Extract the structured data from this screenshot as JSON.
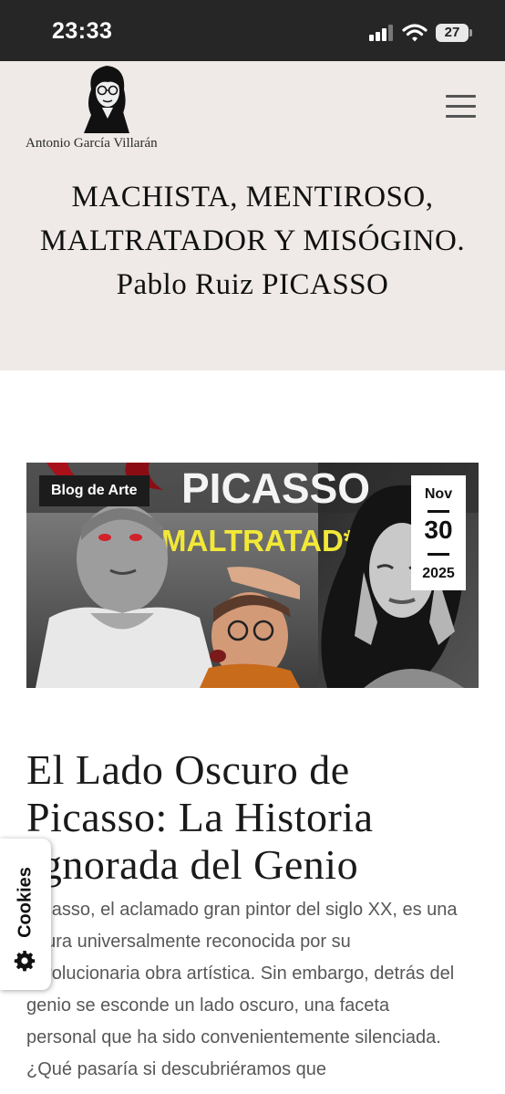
{
  "status_bar": {
    "time": "23:33",
    "battery": "27",
    "icons": [
      "signal-icon",
      "wifi-icon",
      "battery-icon"
    ]
  },
  "header": {
    "site_name": "Antonio García Villarán",
    "menu_icon": "hamburger-menu-icon"
  },
  "page": {
    "title": "MACHISTA, MENTIROSO, MALTRATADOR Y MISÓGINO. Pablo Ruiz PICASSO"
  },
  "post": {
    "category": "Blog de Arte",
    "date": {
      "month": "Nov",
      "day": "30",
      "year": "2025"
    },
    "image_text": {
      "headline": "PICASSO",
      "overlay": "MALTRATAD*R"
    },
    "title": "El Lado Oscuro de Picasso: La Historia Ignorada del Genio",
    "excerpt": "Picasso, el aclamado gran pintor del siglo XX, es una figura universalmente reconocida por su revolucionaria obra artística. Sin embargo, detrás del genio se esconde un lado oscuro, una faceta personal que ha sido convenientemente silenciada. ¿Qué pasaría si descubriéramos que"
  },
  "cookie_tab": {
    "label": "Cookies",
    "icon": "gear-icon"
  },
  "colors": {
    "status_bar_bg": "#262626",
    "header_bg": "#efeae8",
    "badge_bg": "#1c1c1c",
    "overlay_text": "#f2e838"
  }
}
